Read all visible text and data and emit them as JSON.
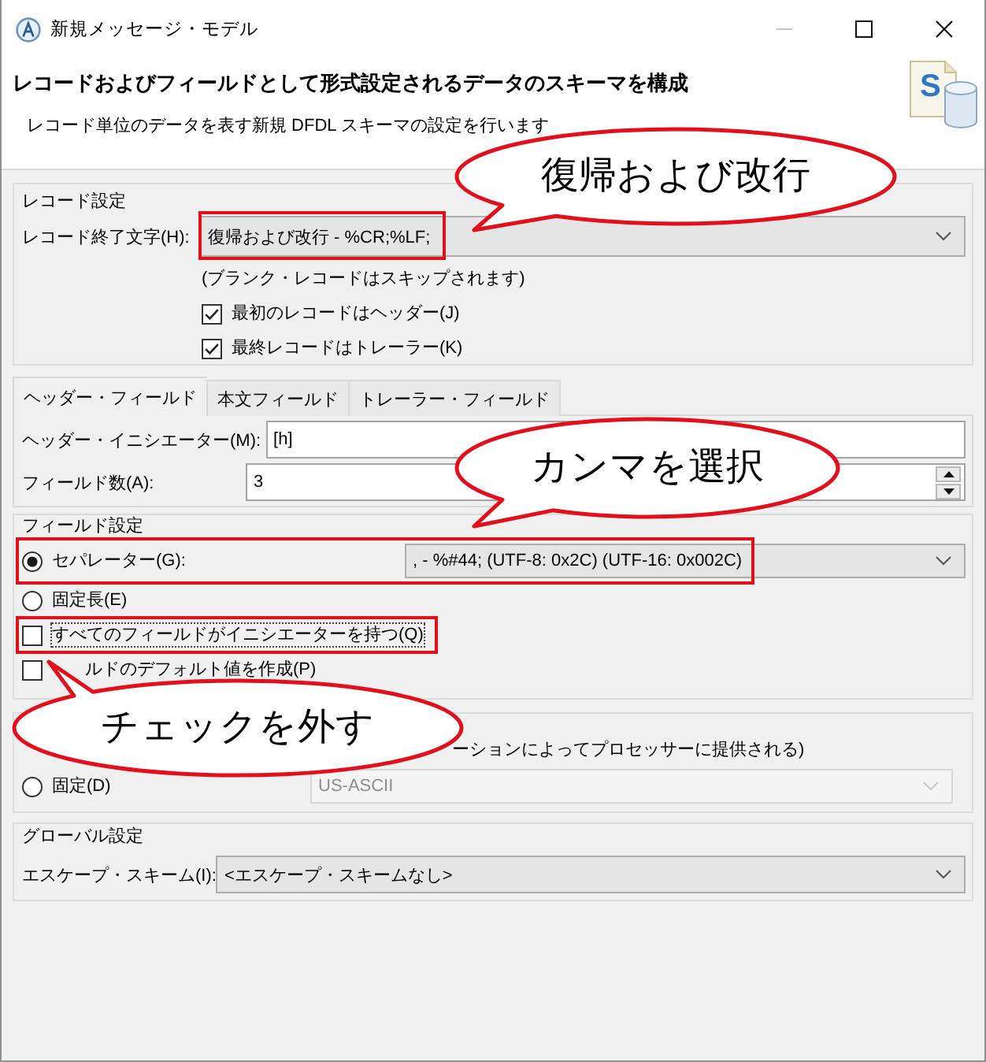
{
  "window": {
    "title": "新規メッセージ・モデル",
    "controls": [
      {
        "kind": "minimize",
        "disabled": true
      },
      {
        "kind": "maximize",
        "disabled": false
      },
      {
        "kind": "close",
        "disabled": false
      }
    ]
  },
  "header": {
    "title": "レコードおよびフィールドとして形式設定されるデータのスキーマを構成",
    "description": "レコード単位のデータを表す新規 DFDL スキーマの設定を行います",
    "icon_letter": "S"
  },
  "record_settings": {
    "title": "レコード設定",
    "terminator": {
      "label": "レコード終了文字(H):",
      "value": "復帰および改行 - %CR;%LF;",
      "highlighted": true
    },
    "note": "(ブランク・レコードはスキップされます)",
    "checkboxes": [
      {
        "label": "最初のレコードはヘッダー(J)",
        "checked": true
      },
      {
        "label": "最終レコードはトレーラー(K)",
        "checked": true
      }
    ]
  },
  "tabs": [
    {
      "label": "ヘッダー・フィールド",
      "selected": true
    },
    {
      "label": "本文フィールド",
      "selected": false
    },
    {
      "label": "トレーラー・フィールド",
      "selected": false
    }
  ],
  "header_fields": {
    "initiator": {
      "label": "ヘッダー・イニシエーター(M):",
      "value": "[h]"
    },
    "field_count": {
      "label": "フィールド数(A):",
      "value": "3"
    }
  },
  "field_settings": {
    "title": "フィールド設定",
    "options": [
      {
        "kind": "radio",
        "label": "セパレーター(G):",
        "selected": true,
        "highlighted": true,
        "combo": {
          "value": ", - %#44; (UTF-8: 0x2C) (UTF-16: 0x002C)",
          "disabled": false
        }
      },
      {
        "kind": "radio",
        "label": "固定長(E)",
        "selected": false,
        "highlighted": false
      },
      {
        "kind": "checkbox",
        "label": "すべてのフィールドがイニシエーターを持つ(Q)",
        "checked": false,
        "highlighted": true,
        "focused": true
      },
      {
        "kind": "checkbox",
        "label": "ルドのデフォルト値を作成(P)",
        "checked": false,
        "highlighted": false,
        "focused": false
      }
    ]
  },
  "encoding": {
    "options": [
      {
        "kind": "text",
        "label": "ーションによってプロセッサーに提供される)"
      },
      {
        "kind": "radio",
        "label": "固定(D)",
        "selected": false,
        "combo": {
          "value": "US-ASCII",
          "disabled": true
        }
      }
    ]
  },
  "global_settings": {
    "title": "グローバル設定",
    "escape_scheme": {
      "label": "エスケープ・スキーム(I):",
      "value": "<エスケープ・スキームなし>"
    }
  },
  "callouts": [
    {
      "text": "復帰および改行"
    },
    {
      "text": "カンマを選択"
    },
    {
      "text": "チェックを外す"
    }
  ]
}
